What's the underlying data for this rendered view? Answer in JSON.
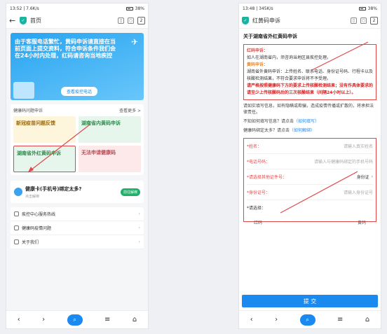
{
  "left": {
    "status": {
      "time": "13:52",
      "speed": "7.6K/s",
      "battery": "38%"
    },
    "address": {
      "title": "首页",
      "tabs": "2"
    },
    "banner": {
      "text": "由于客服电话繁忙，黄码申诉请直接在当前页面上提交资料，符合申诉条件我们会在24小时内处理，红码请咨询当地疾控",
      "button": "查看疫控电话"
    },
    "section": {
      "title": "健康码问题申诉",
      "more": "查看更多 >"
    },
    "tiles": [
      "新冠疫苗问题反馈",
      "湖南省内黄码申诉",
      "湖南省外红黄码申诉",
      "无法申请健康码"
    ],
    "bind": {
      "title": "健康卡(手机号)绑定太多?",
      "subtitle": "点击解绑",
      "button": "前往解绑"
    },
    "menu": [
      "疾控中心服务热线",
      "健康码疫情问题",
      "关于我们"
    ]
  },
  "right": {
    "status": {
      "time": "13:48",
      "speed": "345K/s",
      "battery": "38%"
    },
    "address": {
      "title": "红黄码申诉",
      "tabs": "2"
    },
    "heading": "关于湖南省外红黄码申诉",
    "red_label": "红码申诉：",
    "red_text": "如人在湖南省内，须咨询当地区县疾控处理。",
    "yellow_label": "黄码申诉：",
    "yellow_text": "湖南省外黄码申诉：上传姓名、联系电话、身份证号码、行程卡以及核酸检测结果，不符合要求申诉将不予受理。",
    "warn_text": "请严格按照健康码下方的要求上传核酸检测结果；没有作具体要求的请至少上传核酸码后的三次核酸结果（间隔24小时以上）。",
    "note1": "请如实填写信息，如有隐瞒或欺骗，造成疫情传播或扩散的，将承担法律责任。",
    "note2_prefix": "不知如何填写信息？请点击",
    "note2_link": "（如何填写）",
    "note3_prefix": "健康码绑定太多？请点击",
    "note3_link": "（如何解绑）",
    "form": {
      "name_label": "*姓名：",
      "name_ph": "请输入真实姓名",
      "phone_label": "*电话号码：",
      "phone_ph": "请输入与健康码绑定的手机号码",
      "idtype_label": "*请选择其他证件号：",
      "idtype_val": "身份证",
      "id_label": "*身份证号：",
      "id_ph": "请输入身份证号",
      "choose_label": "*请选择：",
      "red_opt": "红码",
      "yellow_opt": "黄码"
    },
    "submit": "提 交"
  },
  "colors": {
    "primary": "#1b8af0",
    "annotation": "#e04848"
  }
}
